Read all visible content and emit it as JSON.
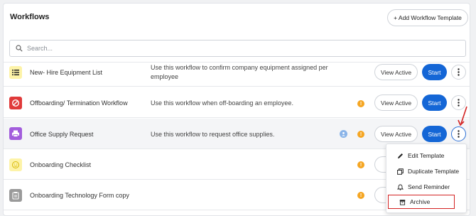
{
  "header": {
    "title": "Workflows",
    "add_button": "+ Add Workflow Template"
  },
  "search": {
    "placeholder": "Search..."
  },
  "rows": [
    {
      "name": "New- Hire Equipment List",
      "description": "Use this workflow to confirm company equipment assigned per employee",
      "icon": "list-icon",
      "icon_color": "#f5d400",
      "icon_bg": "#fdf3a8",
      "view_active": "View Active",
      "start": "Start"
    },
    {
      "name": "Offboarding/ Termination Workflow",
      "description": "Use this workflow when off-boarding an employee.",
      "icon": "prohibited-icon",
      "icon_color": "#e03a3a",
      "icon_bg": "#e03a3a",
      "warn": "!",
      "view_active": "View Active",
      "start": "Start"
    },
    {
      "name": "Office Supply Request",
      "description": "Use this workflow to request office supplies.",
      "icon": "printer-icon",
      "icon_color": "#a25ddc",
      "icon_bg": "#a25ddc",
      "warn": "!",
      "view_active": "View Active",
      "start": "Start"
    },
    {
      "name": "Onboarding Checklist",
      "description": "",
      "icon": "smiley-icon",
      "icon_color": "#f5d400",
      "icon_bg": "#fdf3a8",
      "warn": "!",
      "view_active": "V"
    },
    {
      "name": "Onboarding Technology Form copy",
      "description": "",
      "icon": "clipboard-icon",
      "icon_color": "#9a9a9a",
      "icon_bg": "#9a9a9a",
      "warn": "!",
      "view_active": "V"
    }
  ],
  "menu": {
    "items": [
      {
        "label": "Edit Template",
        "icon": "pencil-icon"
      },
      {
        "label": "Duplicate Template",
        "icon": "duplicate-icon"
      },
      {
        "label": "Send Reminder",
        "icon": "bell-icon"
      },
      {
        "label": "Archive",
        "icon": "archive-icon"
      }
    ]
  },
  "colors": {
    "primary": "#1466d6",
    "warning": "#f5a623",
    "highlight": "#d32222"
  }
}
